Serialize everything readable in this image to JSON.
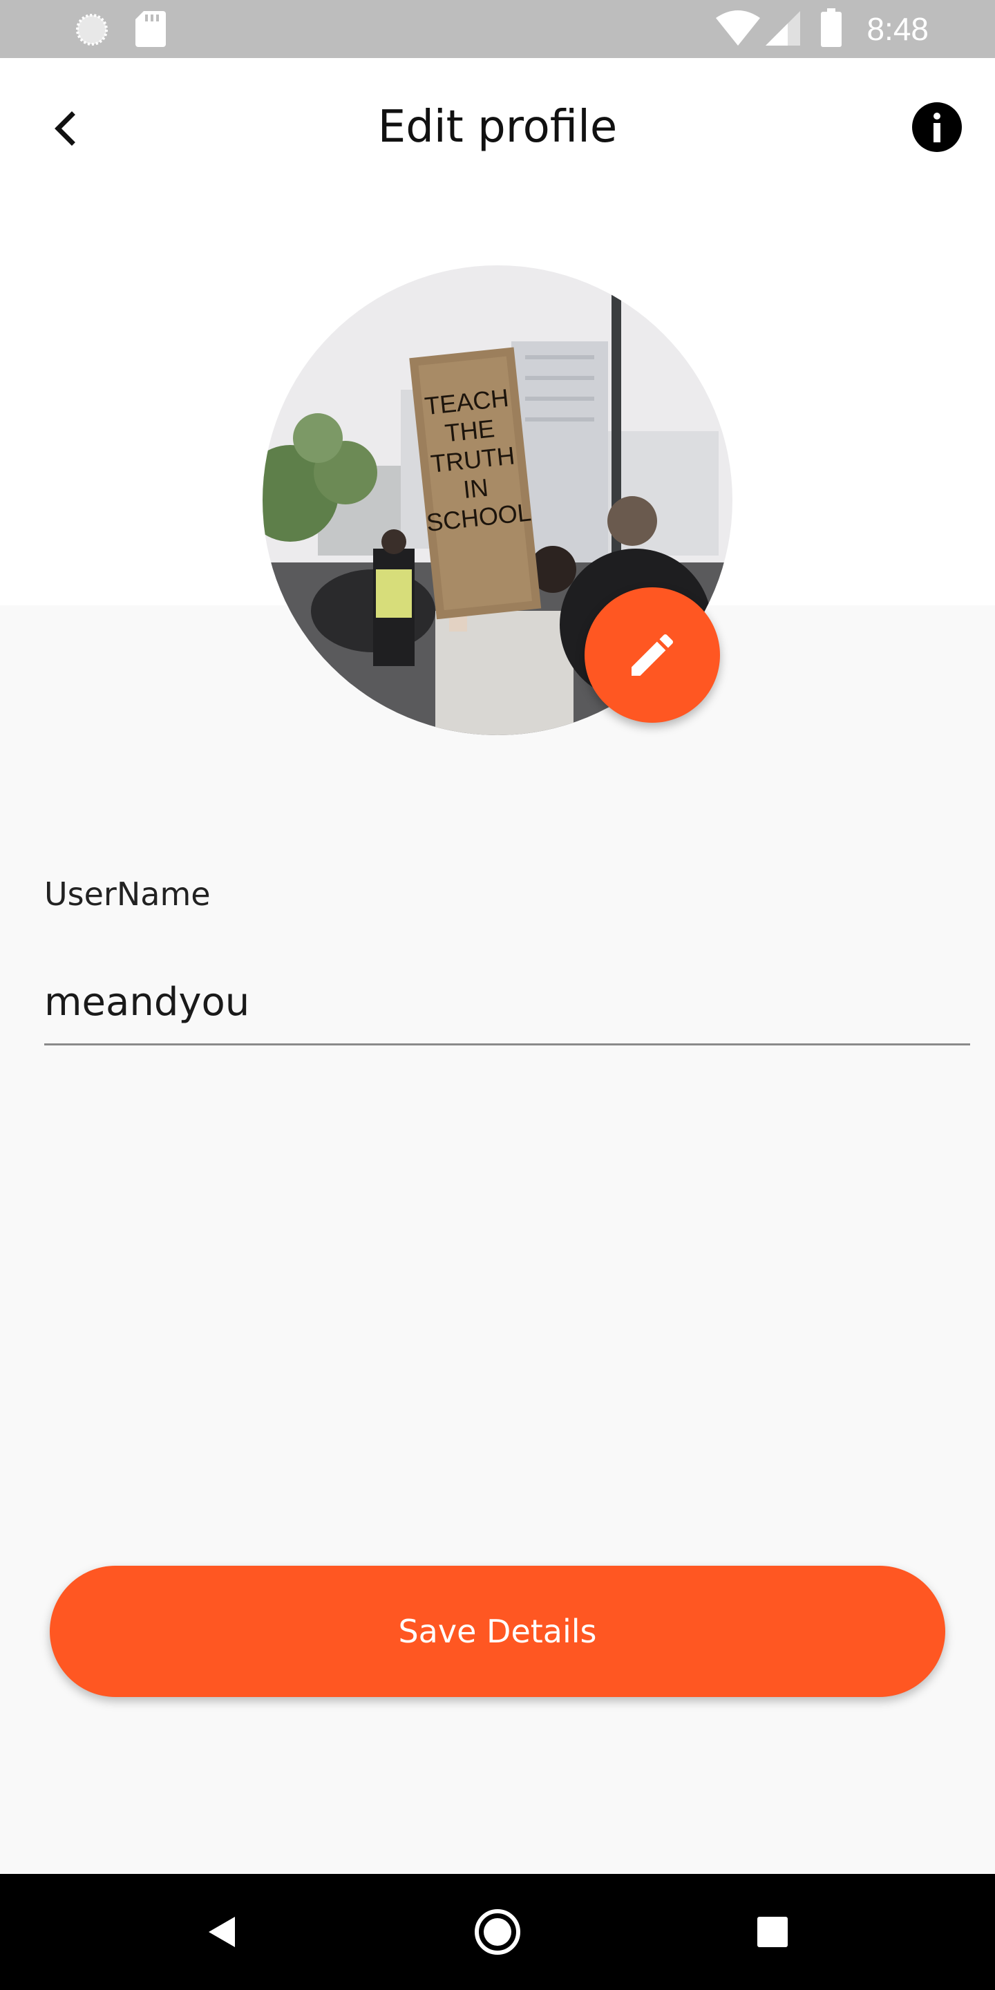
{
  "status_bar": {
    "time": "8:48",
    "icons": [
      "status-circle-icon",
      "sd-card-icon",
      "wifi-icon",
      "cellular-signal-icon",
      "battery-icon"
    ]
  },
  "header": {
    "title": "Edit profile",
    "back_icon": "back-arrow-icon",
    "info_icon": "info-icon"
  },
  "profile": {
    "avatar_sign_text": [
      "TEACH",
      "THE",
      "TRUTH",
      "IN",
      "SCHOOL"
    ],
    "edit_icon": "pencil-icon"
  },
  "form": {
    "username_label": "UserName",
    "username_value": "meandyou"
  },
  "actions": {
    "save_label": "Save Details"
  },
  "nav_bar": {
    "icons": [
      "back-triangle-icon",
      "home-circle-icon",
      "recents-square-icon"
    ]
  },
  "colors": {
    "accent": "#ff5722",
    "status_bar": "#bdbdbd",
    "background": "#f9f9f9",
    "nav_bar": "#000000"
  }
}
